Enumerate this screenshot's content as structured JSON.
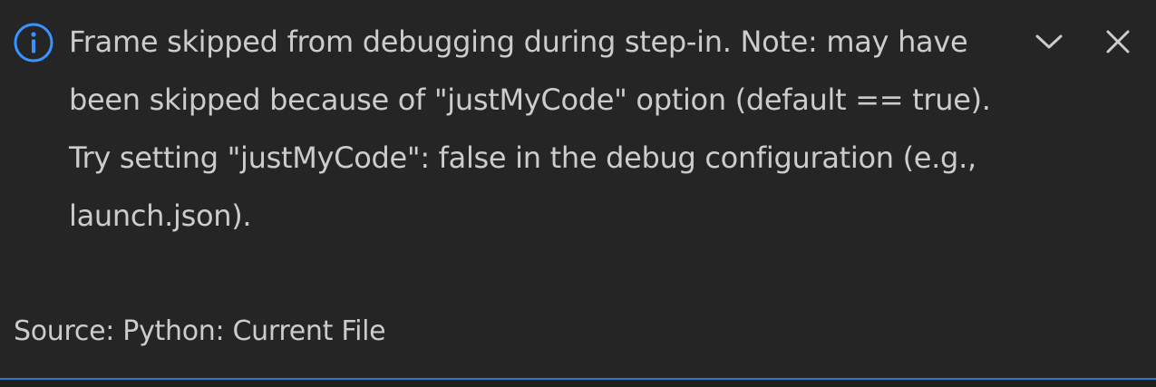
{
  "notification": {
    "icon": "info-icon",
    "message": "Frame skipped from debugging during step-in. Note: may have been skipped because of \"justMyCode\" option (default == true). Try setting \"justMyCode\": false in the debug configuration (e.g., launch.json).",
    "source": "Source: Python: Current File",
    "actions": {
      "collapse_icon": "chevron-down-icon",
      "close_icon": "close-icon"
    }
  },
  "colors": {
    "background": "#252526",
    "text": "#cccccc",
    "info_accent": "#3794ff",
    "border_accent": "#3794ff"
  }
}
